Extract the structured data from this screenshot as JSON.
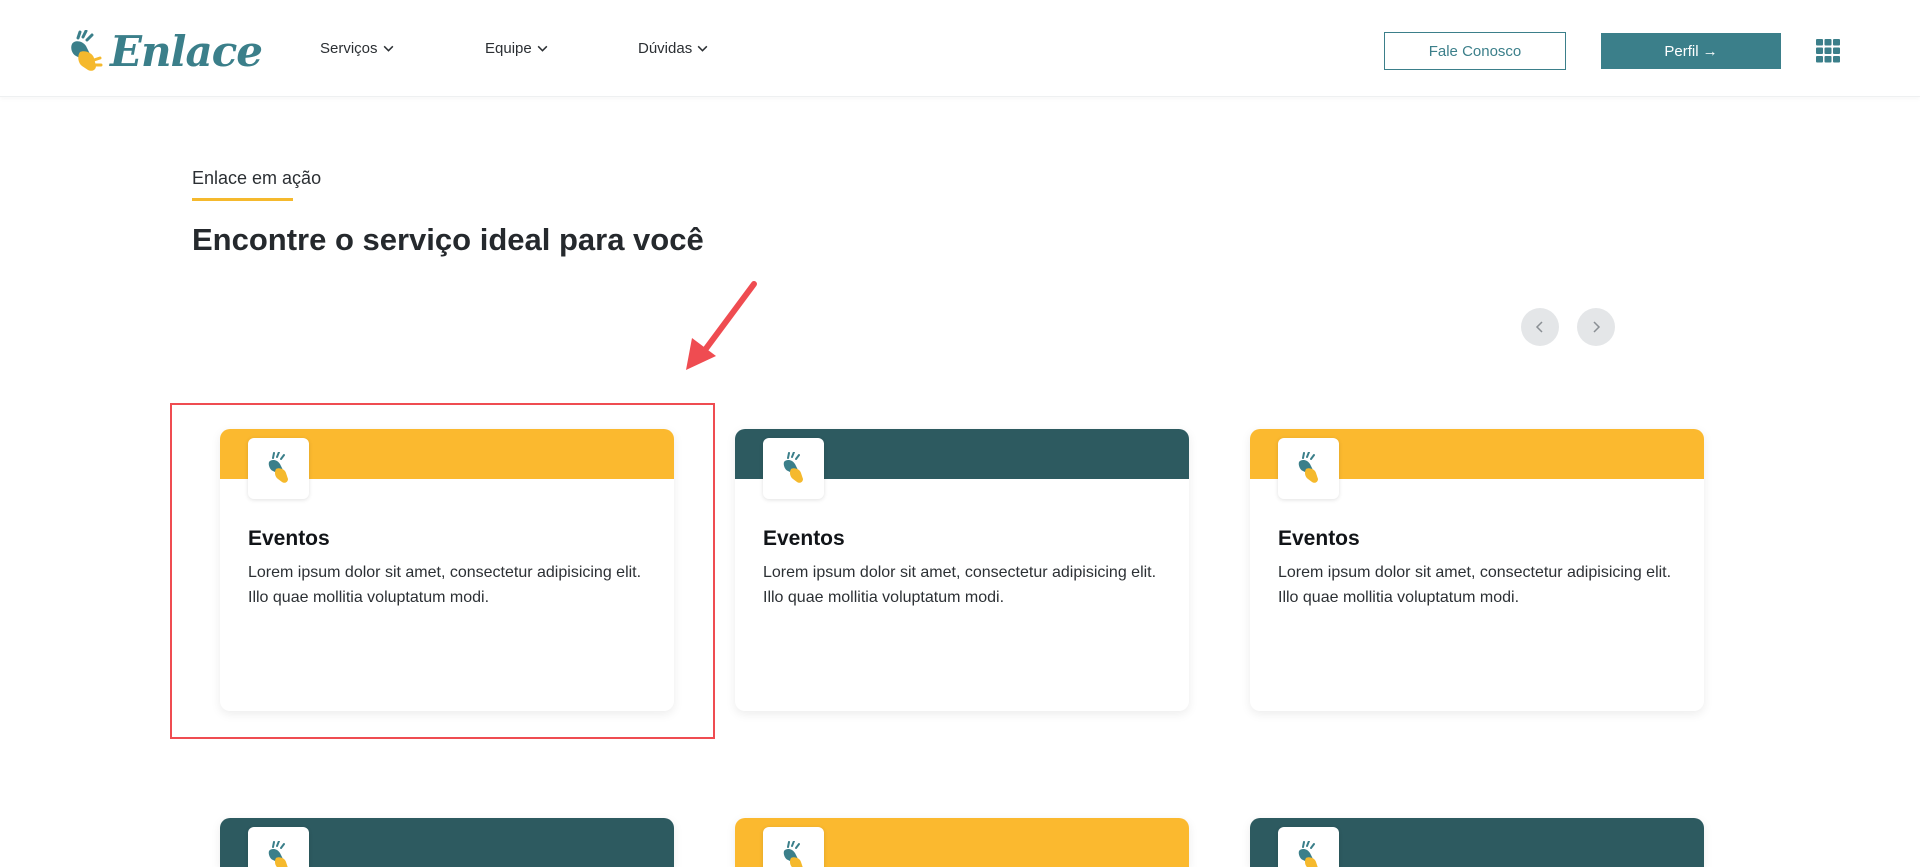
{
  "header": {
    "logo_text": "Enlace",
    "nav": [
      {
        "label": "Serviços"
      },
      {
        "label": "Equipe"
      },
      {
        "label": "Dúvidas"
      }
    ],
    "contact_button": "Fale Conosco",
    "profile_button": "Perfil",
    "profile_arrow": "→"
  },
  "section": {
    "eyebrow": "Enlace em ação",
    "title": "Encontre o serviço ideal para você"
  },
  "colors": {
    "brand_teal": "#3b7f8a",
    "dark_teal": "#2d5a60",
    "yellow": "#fbb92f",
    "highlight_red": "#ef4c51"
  },
  "cards": [
    {
      "title": "Eventos",
      "text": "Lorem ipsum dolor sit amet, consectetur adipisicing elit. Illo quae mollitia voluptatum modi.",
      "band": "yellow"
    },
    {
      "title": "Eventos",
      "text": "Lorem ipsum dolor sit amet, consectetur adipisicing elit. Illo quae mollitia voluptatum modi.",
      "band": "teal"
    },
    {
      "title": "Eventos",
      "text": "Lorem ipsum dolor sit amet, consectetur adipisicing elit. Illo quae mollitia voluptatum modi.",
      "band": "yellow"
    },
    {
      "title": "",
      "text": "",
      "band": "teal"
    },
    {
      "title": "",
      "text": "",
      "band": "yellow"
    },
    {
      "title": "",
      "text": "",
      "band": "teal"
    }
  ],
  "icons": {
    "logo": "hand-sign-icon",
    "nav_chevron": "chevron-down-icon",
    "apps": "grid-apps-icon",
    "prev": "chevron-left-icon",
    "next": "chevron-right-icon",
    "card": "hand-sign-icon"
  }
}
